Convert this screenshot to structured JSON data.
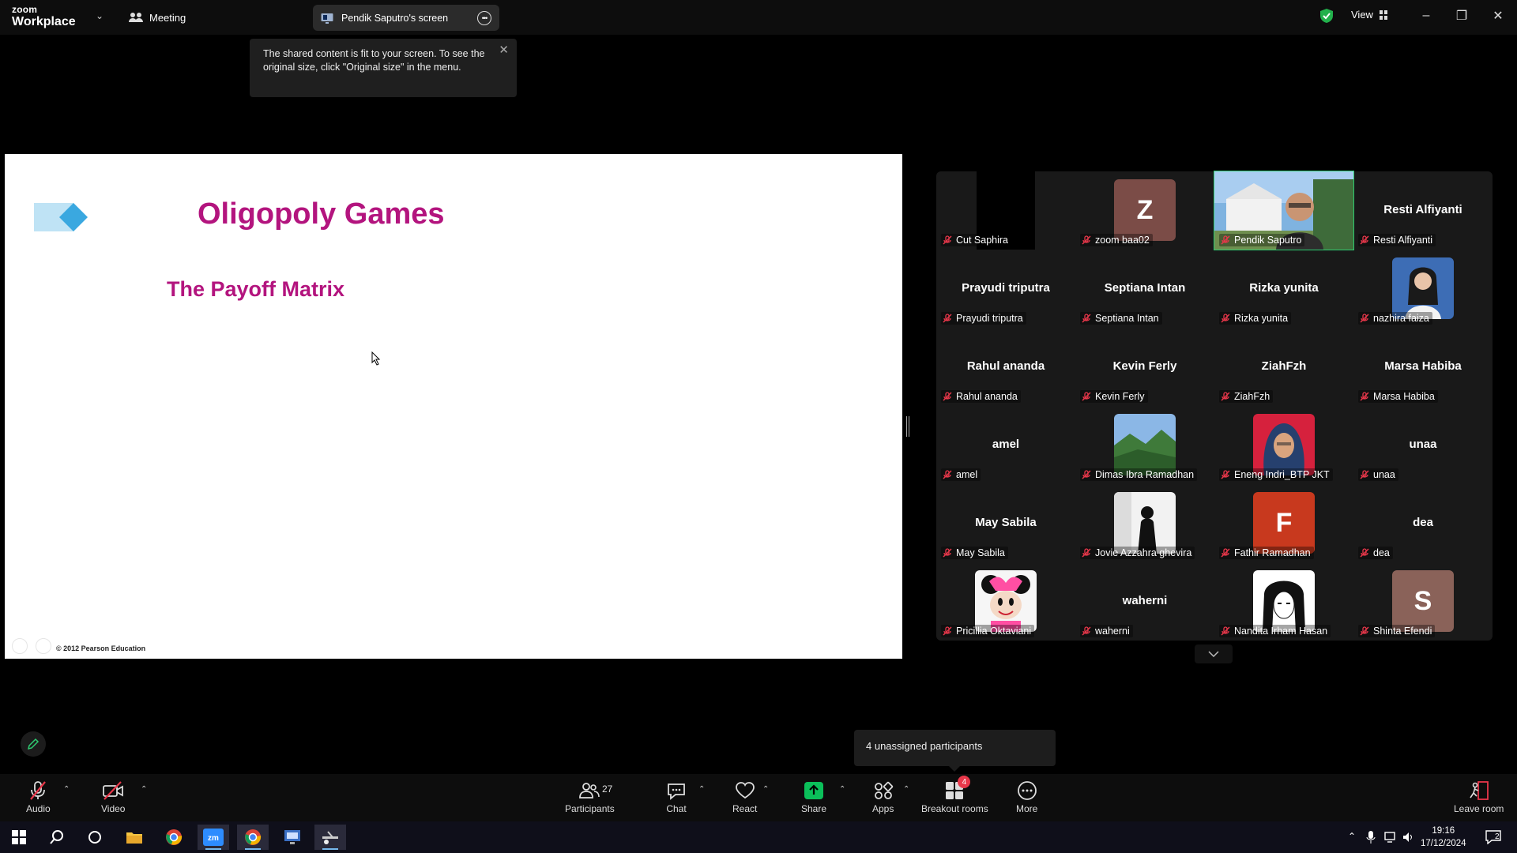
{
  "topbar": {
    "brand_line1": "zoom",
    "brand_line2": "Workplace",
    "meeting_label": "Meeting",
    "screen_tab_label": "Pendik Saputro's screen",
    "view_label": "View"
  },
  "tooltip": {
    "text": "The shared content is fit to your screen. To see the original size, click \"Original size\" in the menu."
  },
  "slide": {
    "title": "Oligopoly Games",
    "subtitle": "The Payoff Matrix",
    "footer": "© 2012 Pearson Education",
    "title_color": "#b3147e"
  },
  "gallery": {
    "tiles": [
      {
        "label": "Cut Saphira",
        "center": "",
        "avatar": "black-video",
        "active": false
      },
      {
        "label": "zoom baa02",
        "center": "",
        "avatar": "Z",
        "avatar_color": "#7b4c47",
        "active": false
      },
      {
        "label": "Pendik Saputro",
        "center": "",
        "avatar": "video",
        "active": true
      },
      {
        "label": "Resti Alfiyanti",
        "center": "Resti Alfiyanti",
        "avatar": "",
        "active": false
      },
      {
        "label": "Prayudi triputra",
        "center": "Prayudi triputra",
        "avatar": "",
        "active": false
      },
      {
        "label": "Septiana Intan",
        "center": "Septiana Intan",
        "avatar": "",
        "active": false
      },
      {
        "label": "Rizka yunita",
        "center": "Rizka yunita",
        "avatar": "",
        "active": false
      },
      {
        "label": "nazhira faiza",
        "center": "",
        "avatar": "photo-portrait",
        "active": false
      },
      {
        "label": "Rahul ananda",
        "center": "Rahul ananda",
        "avatar": "",
        "active": false
      },
      {
        "label": "Kevin Ferly",
        "center": "Kevin Ferly",
        "avatar": "",
        "active": false
      },
      {
        "label": "ZiahFzh",
        "center": "ZiahFzh",
        "avatar": "",
        "active": false
      },
      {
        "label": "Marsa Habiba",
        "center": "Marsa Habiba",
        "avatar": "",
        "active": false
      },
      {
        "label": "amel",
        "center": "amel",
        "avatar": "",
        "active": false
      },
      {
        "label": "Dimas Ibra Ramadhan",
        "center": "",
        "avatar": "photo-landscape",
        "active": false
      },
      {
        "label": "Eneng Indri_BTP JKT",
        "center": "",
        "avatar": "photo-hijab",
        "active": false
      },
      {
        "label": "unaa",
        "center": "unaa",
        "avatar": "",
        "active": false
      },
      {
        "label": "May Sabila",
        "center": "May Sabila",
        "avatar": "",
        "active": false
      },
      {
        "label": "Jovie Azzahra ghevira",
        "center": "",
        "avatar": "photo-silhouette",
        "active": false
      },
      {
        "label": "Fathir Ramadhan",
        "center": "",
        "avatar": "F",
        "avatar_color": "#c8391e",
        "active": false
      },
      {
        "label": "dea",
        "center": "dea",
        "avatar": "",
        "active": false
      },
      {
        "label": "Pricillia Oktaviani",
        "center": "",
        "avatar": "photo-cartoon",
        "active": false
      },
      {
        "label": "waherni",
        "center": "waherni",
        "avatar": "",
        "active": false
      },
      {
        "label": "Nandita Irham Hasan",
        "center": "",
        "avatar": "photo-anime",
        "active": false
      },
      {
        "label": "Shinta Efendi",
        "center": "",
        "avatar": "S",
        "avatar_color": "#8a6259",
        "active": false
      }
    ]
  },
  "breakout": {
    "unassigned_text": "4 unassigned participants",
    "badge": "4"
  },
  "toolbar": {
    "audio": "Audio",
    "video": "Video",
    "participants": "Participants",
    "participants_count": "27",
    "chat": "Chat",
    "react": "React",
    "share": "Share",
    "apps": "Apps",
    "breakout_rooms": "Breakout rooms",
    "more": "More",
    "leave_room": "Leave room",
    "share_color": "#0bbf5a",
    "mute_color": "#e8374a"
  },
  "taskbar": {
    "time": "19:16",
    "date": "17/12/2024",
    "notifications": "2"
  }
}
